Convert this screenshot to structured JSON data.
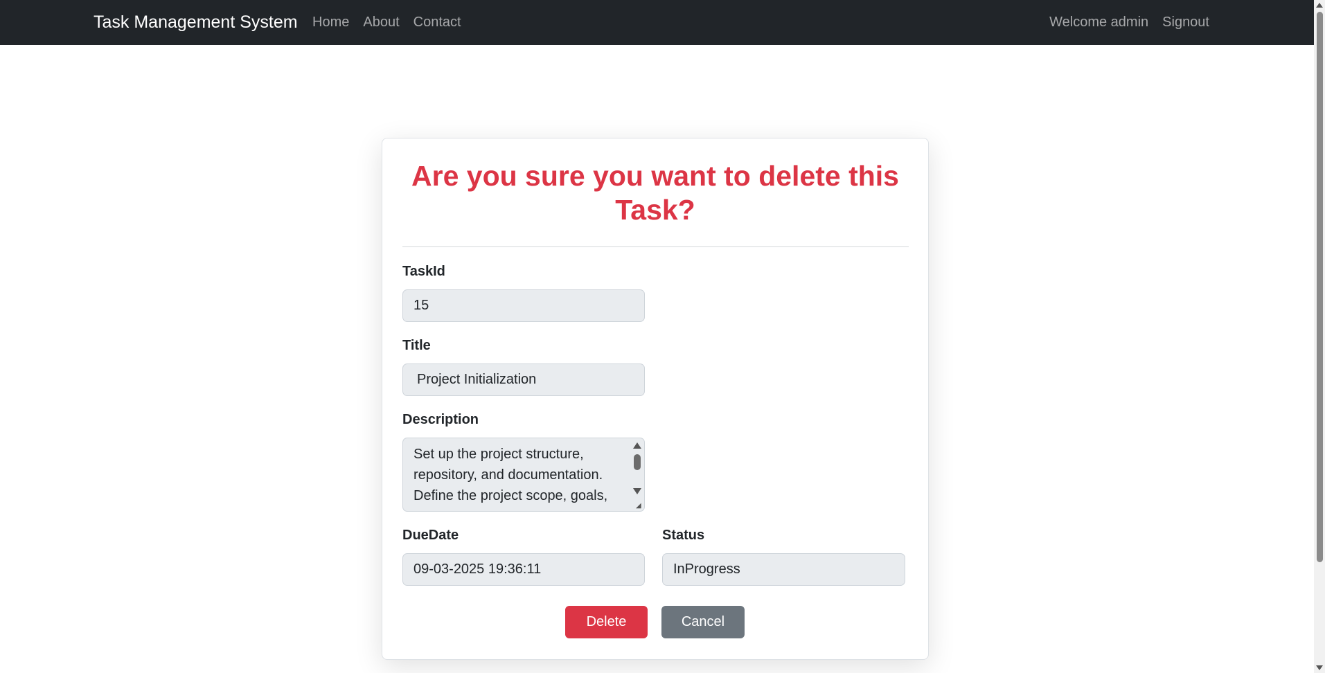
{
  "navbar": {
    "brand": "Task Management System",
    "links": [
      "Home",
      "About",
      "Contact"
    ],
    "welcome": "Welcome admin",
    "signout": "Signout"
  },
  "dialog": {
    "title": "Are you sure you want to delete this Task?",
    "fields": {
      "task_id": {
        "label": "TaskId",
        "value": "15"
      },
      "title": {
        "label": "Title",
        "value": "Project Initialization"
      },
      "description": {
        "label": "Description",
        "value": "Set up the project structure, repository, and documentation. Define the project scope, goals,"
      },
      "due_date": {
        "label": "DueDate",
        "value": "09-03-2025 19:36:11"
      },
      "status": {
        "label": "Status",
        "value": "InProgress"
      }
    },
    "delete_label": "Delete",
    "cancel_label": "Cancel"
  },
  "colors": {
    "danger": "#dc3545",
    "secondary": "#6c757d",
    "navbar_bg": "#212529",
    "field_bg": "#e9ecef"
  }
}
